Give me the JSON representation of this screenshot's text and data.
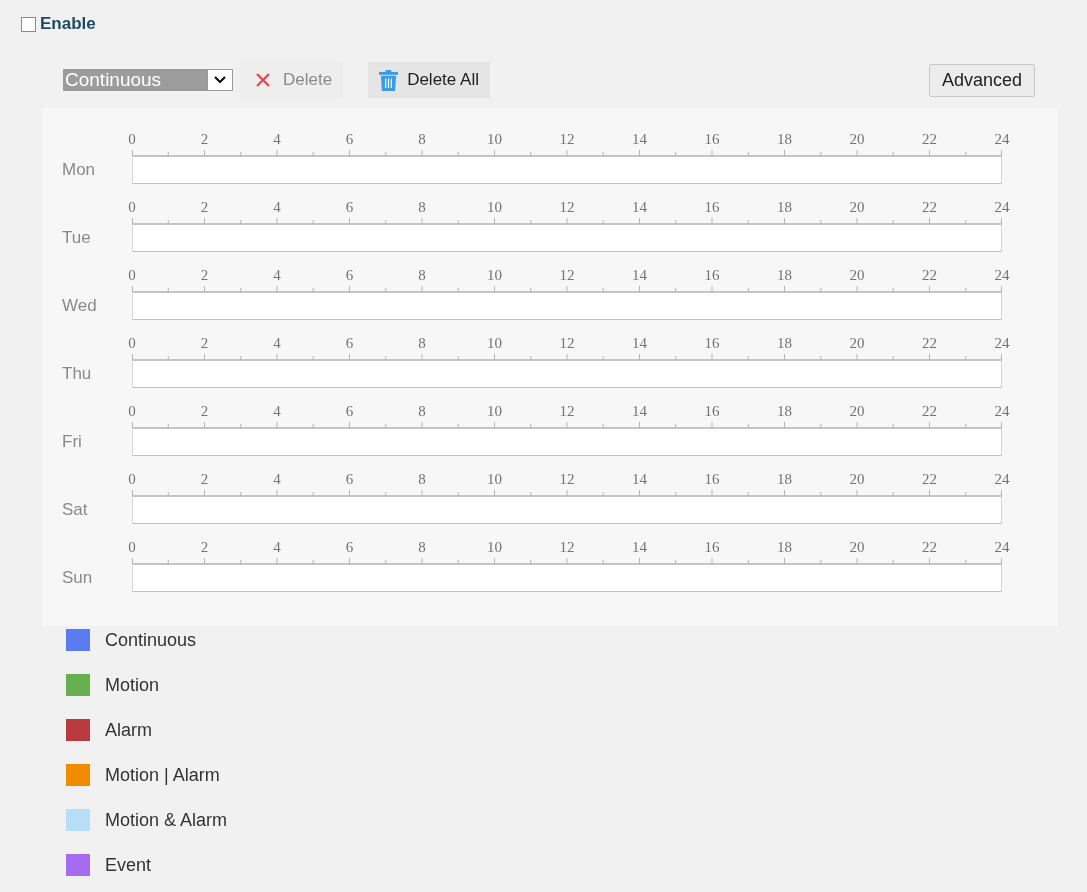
{
  "enable": {
    "label": "Enable",
    "checked": false
  },
  "toolbar": {
    "schedule_type": {
      "value": "Continuous"
    },
    "buttons": [
      {
        "kind": "delete",
        "label": "Delete",
        "disabled": true
      },
      {
        "kind": "delete_all",
        "label": "Delete All",
        "disabled": false
      },
      {
        "kind": "advanced",
        "label": "Advanced",
        "disabled": false
      }
    ]
  },
  "schedule": {
    "days": [
      {
        "label": "Mon",
        "hours": [
          "0",
          "2",
          "4",
          "6",
          "8",
          "10",
          "12",
          "14",
          "16",
          "18",
          "20",
          "22",
          "24"
        ]
      },
      {
        "label": "Tue",
        "hours": [
          "0",
          "2",
          "4",
          "6",
          "8",
          "10",
          "12",
          "14",
          "16",
          "18",
          "20",
          "22",
          "24"
        ]
      },
      {
        "label": "Wed",
        "hours": [
          "0",
          "2",
          "4",
          "6",
          "8",
          "10",
          "12",
          "14",
          "16",
          "18",
          "20",
          "22",
          "24"
        ]
      },
      {
        "label": "Thu",
        "hours": [
          "0",
          "2",
          "4",
          "6",
          "8",
          "10",
          "12",
          "14",
          "16",
          "18",
          "20",
          "22",
          "24"
        ]
      },
      {
        "label": "Fri",
        "hours": [
          "0",
          "2",
          "4",
          "6",
          "8",
          "10",
          "12",
          "14",
          "16",
          "18",
          "20",
          "22",
          "24"
        ]
      },
      {
        "label": "Sat",
        "hours": [
          "0",
          "2",
          "4",
          "6",
          "8",
          "10",
          "12",
          "14",
          "16",
          "18",
          "20",
          "22",
          "24"
        ]
      },
      {
        "label": "Sun",
        "hours": [
          "0",
          "2",
          "4",
          "6",
          "8",
          "10",
          "12",
          "14",
          "16",
          "18",
          "20",
          "22",
          "24"
        ]
      }
    ]
  },
  "legend": [
    {
      "label": "Continuous",
      "color": "#5b7cf0"
    },
    {
      "label": "Motion",
      "color": "#68b04f"
    },
    {
      "label": "Alarm",
      "color": "#b93a3d"
    },
    {
      "label": "Motion | Alarm",
      "color": "#f08c00"
    },
    {
      "label": "Motion & Alarm",
      "color": "#b8ddf8"
    },
    {
      "label": "Event",
      "color": "#a66cf0"
    }
  ]
}
